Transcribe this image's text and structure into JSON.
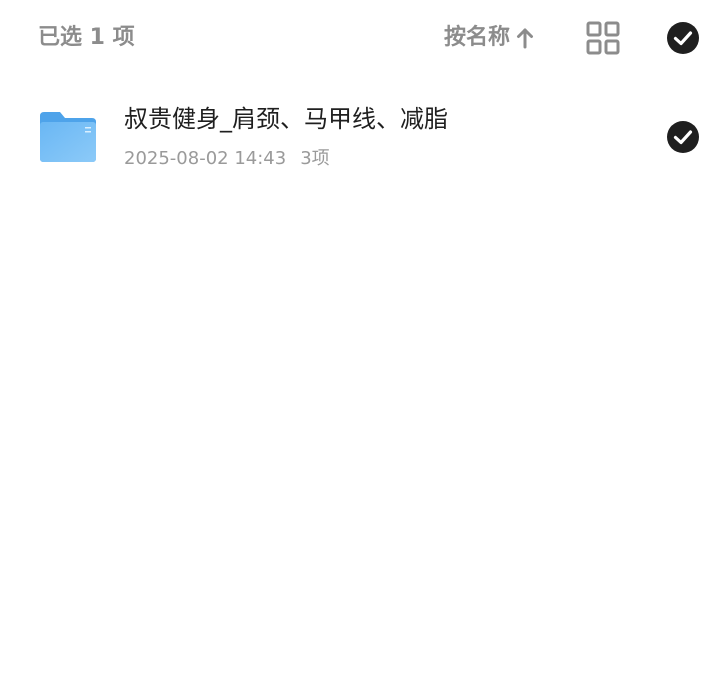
{
  "header": {
    "selected_label": "已选 1 项",
    "sort_label": "按名称",
    "sort_icon": "arrow-up-icon",
    "view_icon": "grid-view-icon",
    "select_all_icon": "check-circle-icon"
  },
  "files": [
    {
      "name": "叔贵健身_肩颈、马甲线、减脂",
      "date": "2025-08-02 14:43",
      "count": "3项",
      "type_icon": "folder-icon",
      "selected": true
    }
  ],
  "colors": {
    "muted_text": "#8c8c8c",
    "primary_text": "#1f1f1f",
    "check_fill": "#1f1f1f",
    "folder_blue": "#5aaef0"
  }
}
